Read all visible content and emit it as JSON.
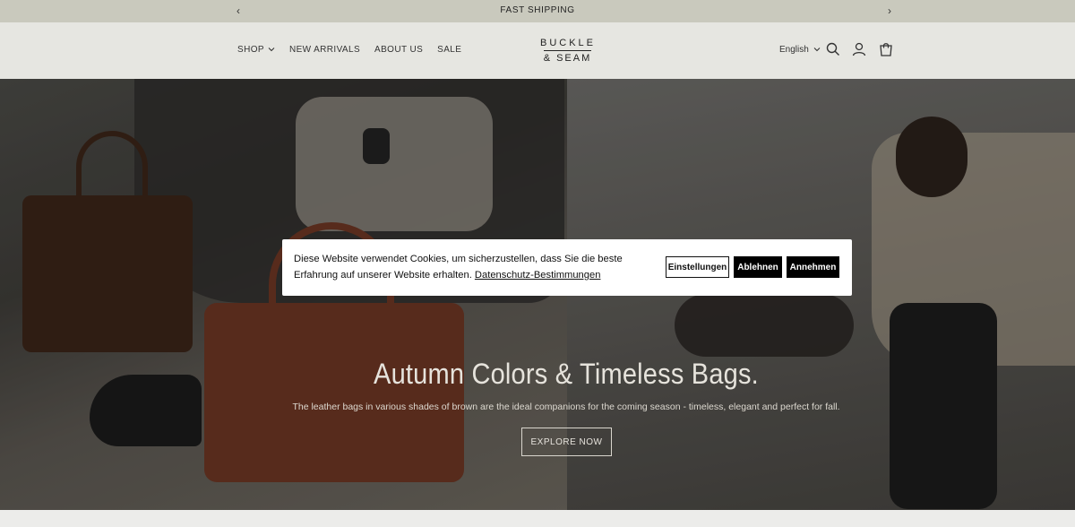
{
  "announcement": {
    "prev_label": "‹",
    "message": "FAST SHIPPING",
    "next_label": "›"
  },
  "header": {
    "nav": {
      "shop": "SHOP",
      "new_arrivals": "NEW ARRIVALS",
      "about": "ABOUT US",
      "sale": "SALE"
    },
    "logo": {
      "line1": "BUCKLE",
      "line2": "& SEAM"
    },
    "language": "English",
    "icons": [
      "search-icon",
      "account-icon",
      "cart-icon"
    ]
  },
  "hero": {
    "title": "Autumn Colors & Timeless Bags.",
    "subtitle": "The leather bags in various shades of brown are the ideal companions for the coming season - timeless, elegant and perfect for fall.",
    "cta": "EXPLORE NOW"
  },
  "cookie_banner": {
    "message": "Diese Website verwendet Cookies, um sicherzustellen, dass Sie die beste Erfahrung auf unserer Website erhalten.",
    "policy_link": "Datenschutz-Bestimmungen",
    "settings_button": "Einstellungen",
    "reject_button": "Ablehnen",
    "accept_button": "Annehmen"
  },
  "colors": {
    "announcement_bg": "#c9c9bd",
    "header_bg": "#e6e6e1",
    "button_dark": "#000000"
  }
}
